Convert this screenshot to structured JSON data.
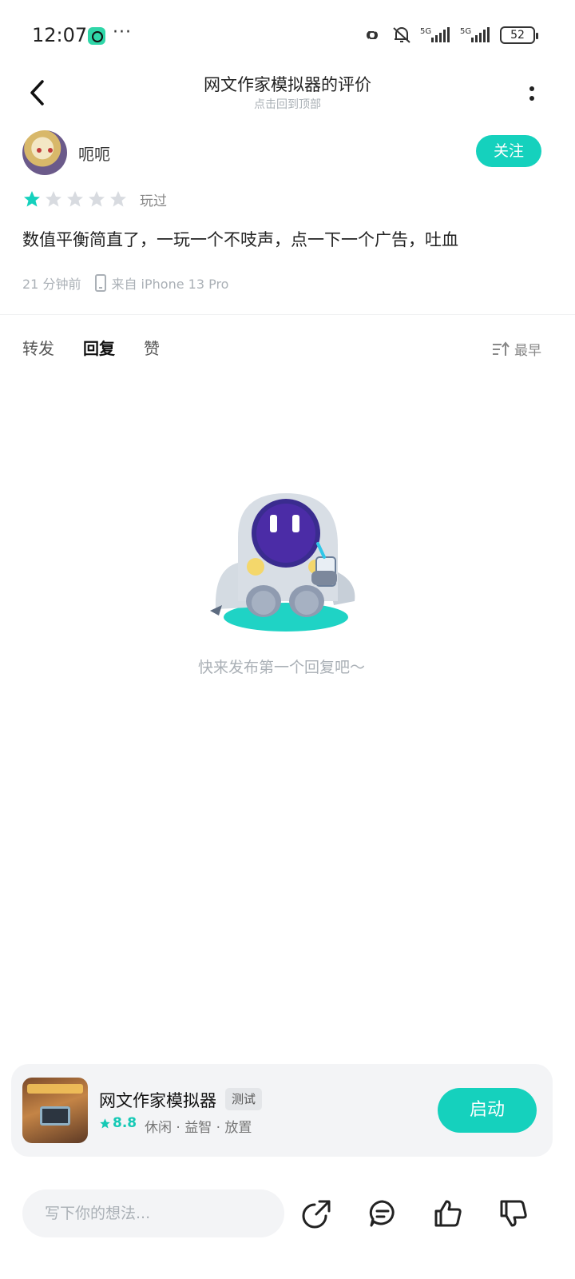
{
  "status_bar": {
    "time": "12:07",
    "overflow": "···",
    "battery": "52"
  },
  "header": {
    "title": "网文作家模拟器的评价",
    "subtitle": "点击回到顶部"
  },
  "review": {
    "author": "呃呃",
    "follow_label": "关注",
    "rating": 1,
    "rating_max": 5,
    "played_label": "玩过",
    "text": "数值平衡简直了，一玩一个不吱声，点一下一个广告，吐血",
    "time": "21 分钟前",
    "device": "来自 iPhone 13 Pro"
  },
  "tabs": {
    "items": [
      "转发",
      "回复",
      "赞"
    ],
    "active_index": 1,
    "sort_label": "最早"
  },
  "empty_state": {
    "text": "快来发布第一个回复吧～"
  },
  "game": {
    "name": "网文作家模拟器",
    "tag": "测试",
    "score": "8.8",
    "genres": "休闲 · 益智 · 放置",
    "launch_label": "启动"
  },
  "bottom_bar": {
    "placeholder": "写下你的想法..."
  },
  "colors": {
    "accent": "#15d1bd",
    "star_inactive": "#d8dbe0",
    "muted": "#aab0b6"
  },
  "icons": {
    "back": "chevron-left-icon",
    "more": "more-vertical-icon",
    "sort": "sort-icon",
    "share": "share-icon",
    "comment": "comment-icon",
    "like": "thumb-up-icon",
    "dislike": "thumb-down-icon"
  }
}
